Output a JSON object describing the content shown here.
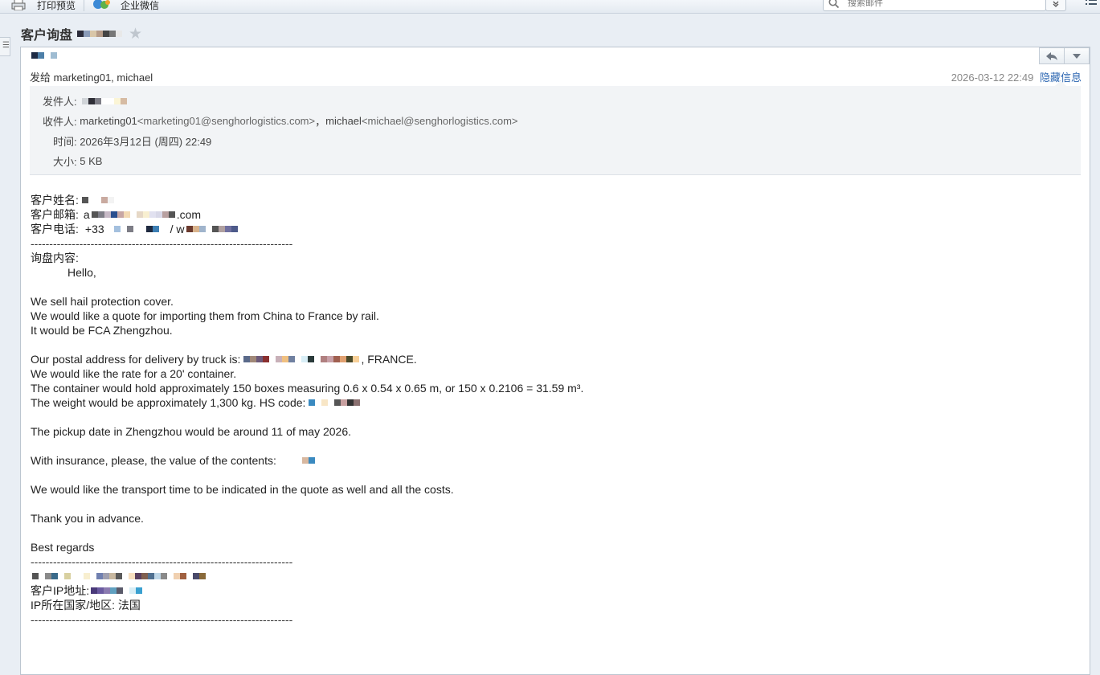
{
  "toolbar": {
    "print_preview": "打印预览",
    "wecom": "企业微信",
    "search_placeholder": "搜索邮件"
  },
  "subject": {
    "title": "客户询盘"
  },
  "header": {
    "to_prefix": "发给",
    "to_names": "marketing01, michael",
    "date": "2026-03-12 22:49",
    "hide_info": "隐藏信息"
  },
  "info": {
    "from_label": "发件人:",
    "to_label": "收件人:",
    "to_name1": "marketing01",
    "to_addr1": "<marketing01@senghorlogistics.com>",
    "to_sep": "，",
    "to_name2": "michael",
    "to_addr2": "<michael@senghorlogistics.com>",
    "time_label": "时间:",
    "time_value": "2026年3月12日 (周四) 22:49",
    "size_label": "大小:",
    "size_value": "5 KB"
  },
  "body": {
    "name_label": "客户姓名:",
    "email_label": "客户邮箱:",
    "email_prefix": "a",
    "email_suffix": ".com",
    "phone_label": "客户电话:",
    "phone_prefix": "+33",
    "phone_sep": "/ w",
    "divider": "----------------------------------------------------------------------",
    "inquiry_label": "询盘内容:",
    "hello": "Hello,",
    "line1": "We sell hail protection cover.",
    "line2": "We would like a quote for importing them from China to France by rail.",
    "line3": "It would be FCA Zhengzhou.",
    "line4": "Our postal address for delivery by truck is:",
    "line4_end": ", FRANCE.",
    "line5": "We would like the rate for a 20' container.",
    "line6": "The container would hold approximately 150 boxes measuring 0.6 x 0.54 x 0.65 m, or 150 x 0.2106 = 31.59 m³.",
    "line7": "The weight would be approximately 1,300 kg. HS code:",
    "line8": "The pickup date in Zhengzhou would be around 11 of may 2026.",
    "line9": "With insurance, please, the value of the contents:",
    "line10": "We would like the transport time to be indicated in the quote as well and all the costs.",
    "line11": "Thank you in advance.",
    "line12": "Best regards",
    "ip_label": "客户IP地址:",
    "country_label": "IP所在国家/地区:",
    "country_value": "法国"
  }
}
